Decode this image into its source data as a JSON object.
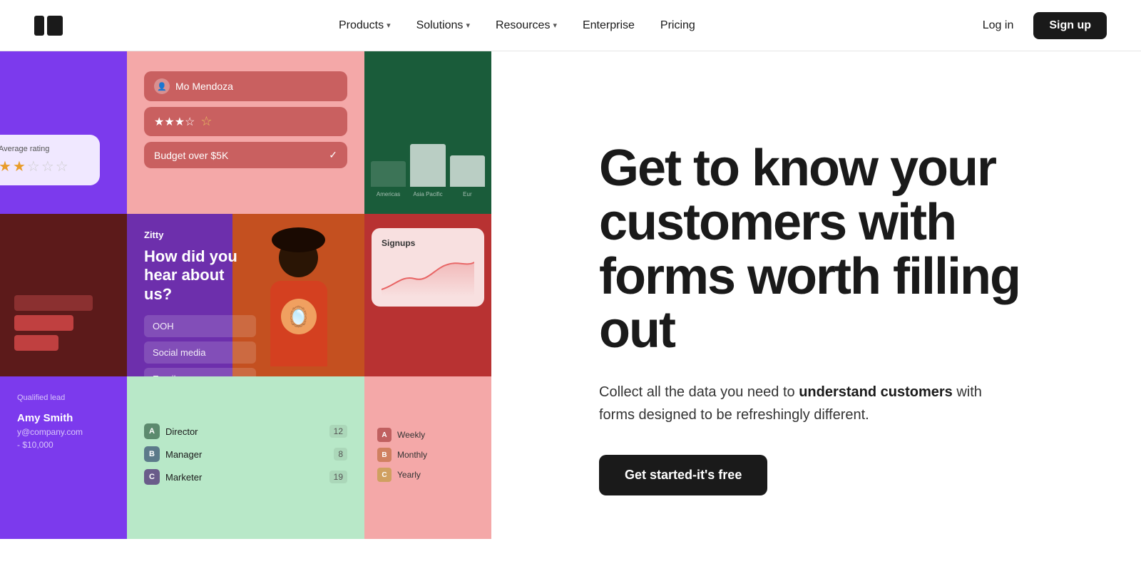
{
  "nav": {
    "logo_bar1": "",
    "logo_bar2": "",
    "items": [
      {
        "label": "Products",
        "has_chevron": true
      },
      {
        "label": "Solutions",
        "has_chevron": true
      },
      {
        "label": "Resources",
        "has_chevron": true
      },
      {
        "label": "Enterprise",
        "has_chevron": false
      },
      {
        "label": "Pricing",
        "has_chevron": false
      }
    ],
    "login_label": "Log in",
    "signup_label": "Sign up"
  },
  "collage": {
    "avg_rating_label": "Average rating",
    "stars_filled": 2,
    "stars_empty": 3,
    "filter_name": "Mo Mendoza",
    "filter_stars": "★★★☆",
    "filter_budget": "Budget over $5K",
    "chart_labels": [
      "Americas",
      "Asia Pacific",
      "Eur"
    ],
    "survey_company": "Zitty",
    "survey_question": "How did you hear about us?",
    "survey_options": [
      "OOH",
      "Social media",
      "Email"
    ],
    "signups_title": "Signups",
    "lead_label": "Qualified lead",
    "lead_name": "Amy Smith",
    "lead_email": "y@company.com",
    "lead_budget": "- $10,000",
    "ranking": [
      {
        "letter": "A",
        "label": "Director",
        "count": "12"
      },
      {
        "letter": "B",
        "label": "Manager",
        "count": "8"
      },
      {
        "letter": "C",
        "label": "Marketer",
        "count": "19"
      }
    ],
    "periods": [
      {
        "letter": "A",
        "label": "Weekly"
      },
      {
        "letter": "B",
        "label": "Monthly"
      },
      {
        "letter": "C",
        "label": "Yearly"
      }
    ]
  },
  "hero": {
    "headline": "Get to know your customers with forms worth filling out",
    "subtext_normal": "Collect all the data you need to ",
    "subtext_bold": "understand customers",
    "subtext_end": " with forms designed to be refreshingly different.",
    "cta_label": "Get started-it's free"
  }
}
